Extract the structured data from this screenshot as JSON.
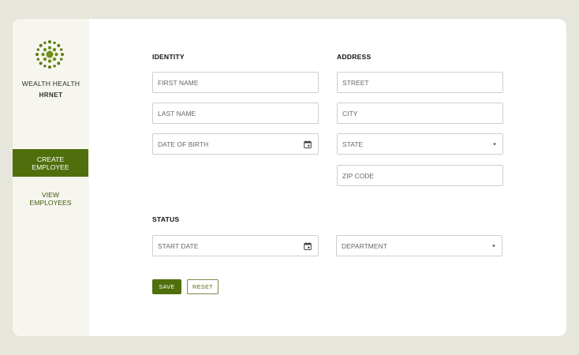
{
  "app": {
    "brand_name": "WEALTH HEALTH",
    "brand_sub": "HRNET"
  },
  "nav": {
    "items": [
      {
        "label": "CREATE EMPLOYEE",
        "active": true
      },
      {
        "label": "VIEW EMPLOYEES",
        "active": false
      }
    ]
  },
  "form": {
    "identity": {
      "title": "IDENTITY",
      "first_name": "FIRST NAME",
      "last_name": "LAST NAME",
      "date_of_birth": "DATE OF BIRTH"
    },
    "address": {
      "title": "ADDRESS",
      "street": "STREET",
      "city": "CITY",
      "state": "STATE",
      "zip": "ZIP CODE"
    },
    "status": {
      "title": "STATUS",
      "start_date": "START DATE",
      "department": "DEPARTMENT"
    },
    "buttons": {
      "save": "SAVE",
      "reset": "RESET"
    }
  },
  "colors": {
    "accent": "#4f6f0c",
    "page_bg": "#e6e6dc",
    "sidebar_bg": "#f6f6ef"
  },
  "icons": {
    "logo": "mandala-logo-icon",
    "calendar": "calendar-icon",
    "dropdown": "chevron-down-icon"
  }
}
